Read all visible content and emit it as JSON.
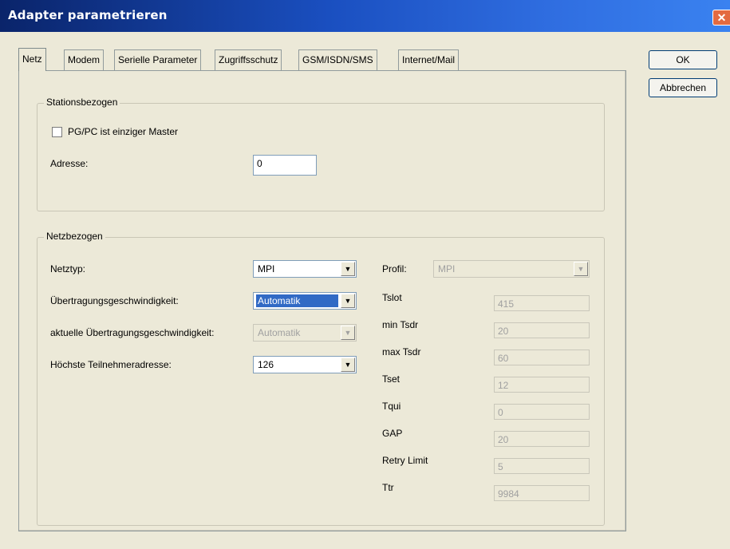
{
  "window": {
    "title": "Adapter parametrieren",
    "close_glyph": "✕"
  },
  "tabs": [
    {
      "label": "Netz",
      "active": true
    },
    {
      "label": "Modem"
    },
    {
      "label": "Serielle Parameter"
    },
    {
      "label": "Zugriffsschutz"
    },
    {
      "label": "GSM/ISDN/SMS"
    },
    {
      "label": "Internet/Mail"
    }
  ],
  "buttons": {
    "ok": "OK",
    "cancel": "Abbrechen"
  },
  "station": {
    "title": "Stationsbezogen",
    "only_master_label": "PG/PC ist einziger Master",
    "only_master_checked": false,
    "address_label": "Adresse:",
    "address_value": "0"
  },
  "network": {
    "title": "Netzbezogen",
    "net_type_label": "Netztyp:",
    "net_type_value": "MPI",
    "baud_label": "Übertragungsgeschwindigkeit:",
    "baud_value": "Automatik",
    "current_baud_label": "aktuelle Übertragungsgeschwindigkeit:",
    "current_baud_value": "Automatik",
    "highest_addr_label": "Höchste Teilnehmeradresse:",
    "highest_addr_value": "126",
    "profile_label": "Profil:",
    "profile_value": "MPI",
    "params": [
      {
        "label": "Tslot",
        "value": "415"
      },
      {
        "label": "min Tsdr",
        "value": "20"
      },
      {
        "label": "max Tsdr",
        "value": "60"
      },
      {
        "label": "Tset",
        "value": "12"
      },
      {
        "label": "Tqui",
        "value": "0"
      },
      {
        "label": "GAP",
        "value": "20"
      },
      {
        "label": "Retry Limit",
        "value": "5"
      },
      {
        "label": "Ttr",
        "value": "9984"
      }
    ]
  },
  "icons": {
    "dropdown_arrow": "▼"
  }
}
